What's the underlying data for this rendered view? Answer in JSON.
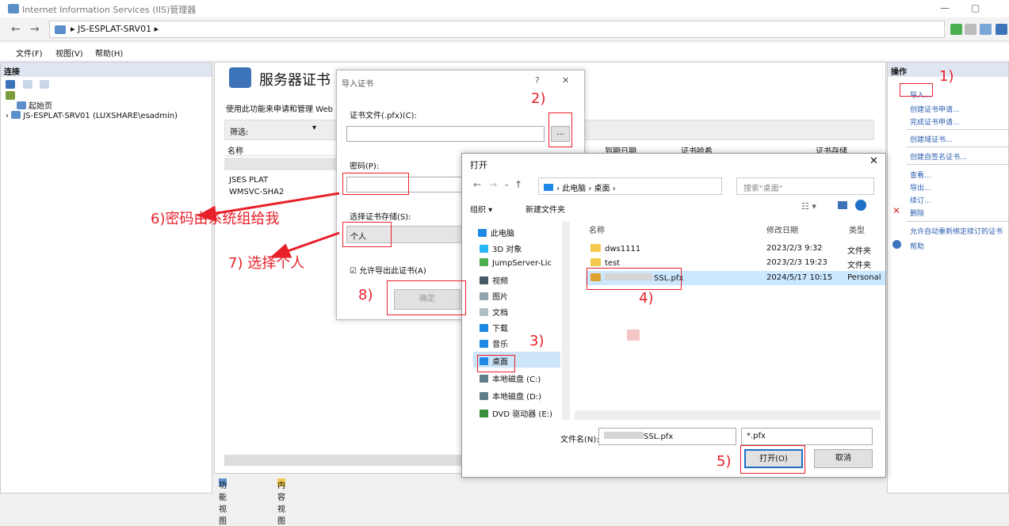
{
  "window": {
    "title": "Internet Information Services (IIS)管理器"
  },
  "address": {
    "path": "JS-ESPLAT-SRV01",
    "sep": "▸"
  },
  "menu": [
    "文件(F)",
    "视图(V)",
    "帮助(H)"
  ],
  "left": {
    "header": "连接",
    "tree": [
      "起始页",
      "JS-ESPLAT-SRV01 (LUXSHARE\\esadmin)"
    ]
  },
  "center": {
    "title": "服务器证书",
    "desc": "使用此功能来申请和管理 Web",
    "filter": "筛选:",
    "columns": [
      "名称",
      "到期日期",
      "证书哈希",
      "证书存储"
    ],
    "rows": [
      "JSES PLAT",
      "WMSVC-SHA2"
    ],
    "tabs": [
      "功能视图",
      "内容视图"
    ]
  },
  "right": {
    "header": "操作",
    "actions": [
      "导入...",
      "创建证书申请...",
      "完成证书申请...",
      "创建域证书...",
      "创建自签名证书...",
      "查看...",
      "导出...",
      "续订...",
      "删除",
      "允许自动重新绑定续订的证书",
      "帮助"
    ]
  },
  "import": {
    "title": "导入证书",
    "file_label": "证书文件(.pfx)(C):",
    "browse": "...",
    "password_label": "密码(P):",
    "store_label": "选择证书存储(S):",
    "store_value": "个人",
    "allow_export": "允许导出此证书(A)",
    "ok": "确定",
    "help": "?",
    "close": "✕"
  },
  "open": {
    "title": "打开",
    "path": [
      "此电脑",
      "桌面"
    ],
    "search_placeholder": "搜索\"桌面\"",
    "organize": "组织 ▾",
    "new_folder": "新建文件夹",
    "nav": [
      "此电脑",
      "3D 对象",
      "JumpServer-Lic",
      "视频",
      "图片",
      "文档",
      "下载",
      "音乐",
      "桌面",
      "本地磁盘 (C:)",
      "本地磁盘 (D:)",
      "DVD 驱动器 (E:)"
    ],
    "columns": [
      "名称",
      "修改日期",
      "类型"
    ],
    "files": [
      {
        "name": "dws1111",
        "date": "2023/2/3 9:32",
        "type": "文件夹"
      },
      {
        "name": "test",
        "date": "2023/2/3 19:23",
        "type": "文件夹"
      },
      {
        "name": "SSL.pfx",
        "date": "2024/5/17 10:15",
        "type": "Personal"
      }
    ],
    "filename_label": "文件名(N):",
    "filename_value": "SSL.pfx",
    "filetype": "*.pfx",
    "open_btn": "打开(O)",
    "cancel_btn": "取消"
  },
  "annotations": {
    "a1": "1)",
    "a2": "2)",
    "a3": "3)",
    "a4": "4)",
    "a5": "5)",
    "a6": "6)密码由系统组给我",
    "a7": "7) 选择个人",
    "a8": "8)"
  },
  "colors": {
    "annotation": "#e8202a",
    "link": "#2a5db0",
    "accent": "#5b8fc9"
  }
}
